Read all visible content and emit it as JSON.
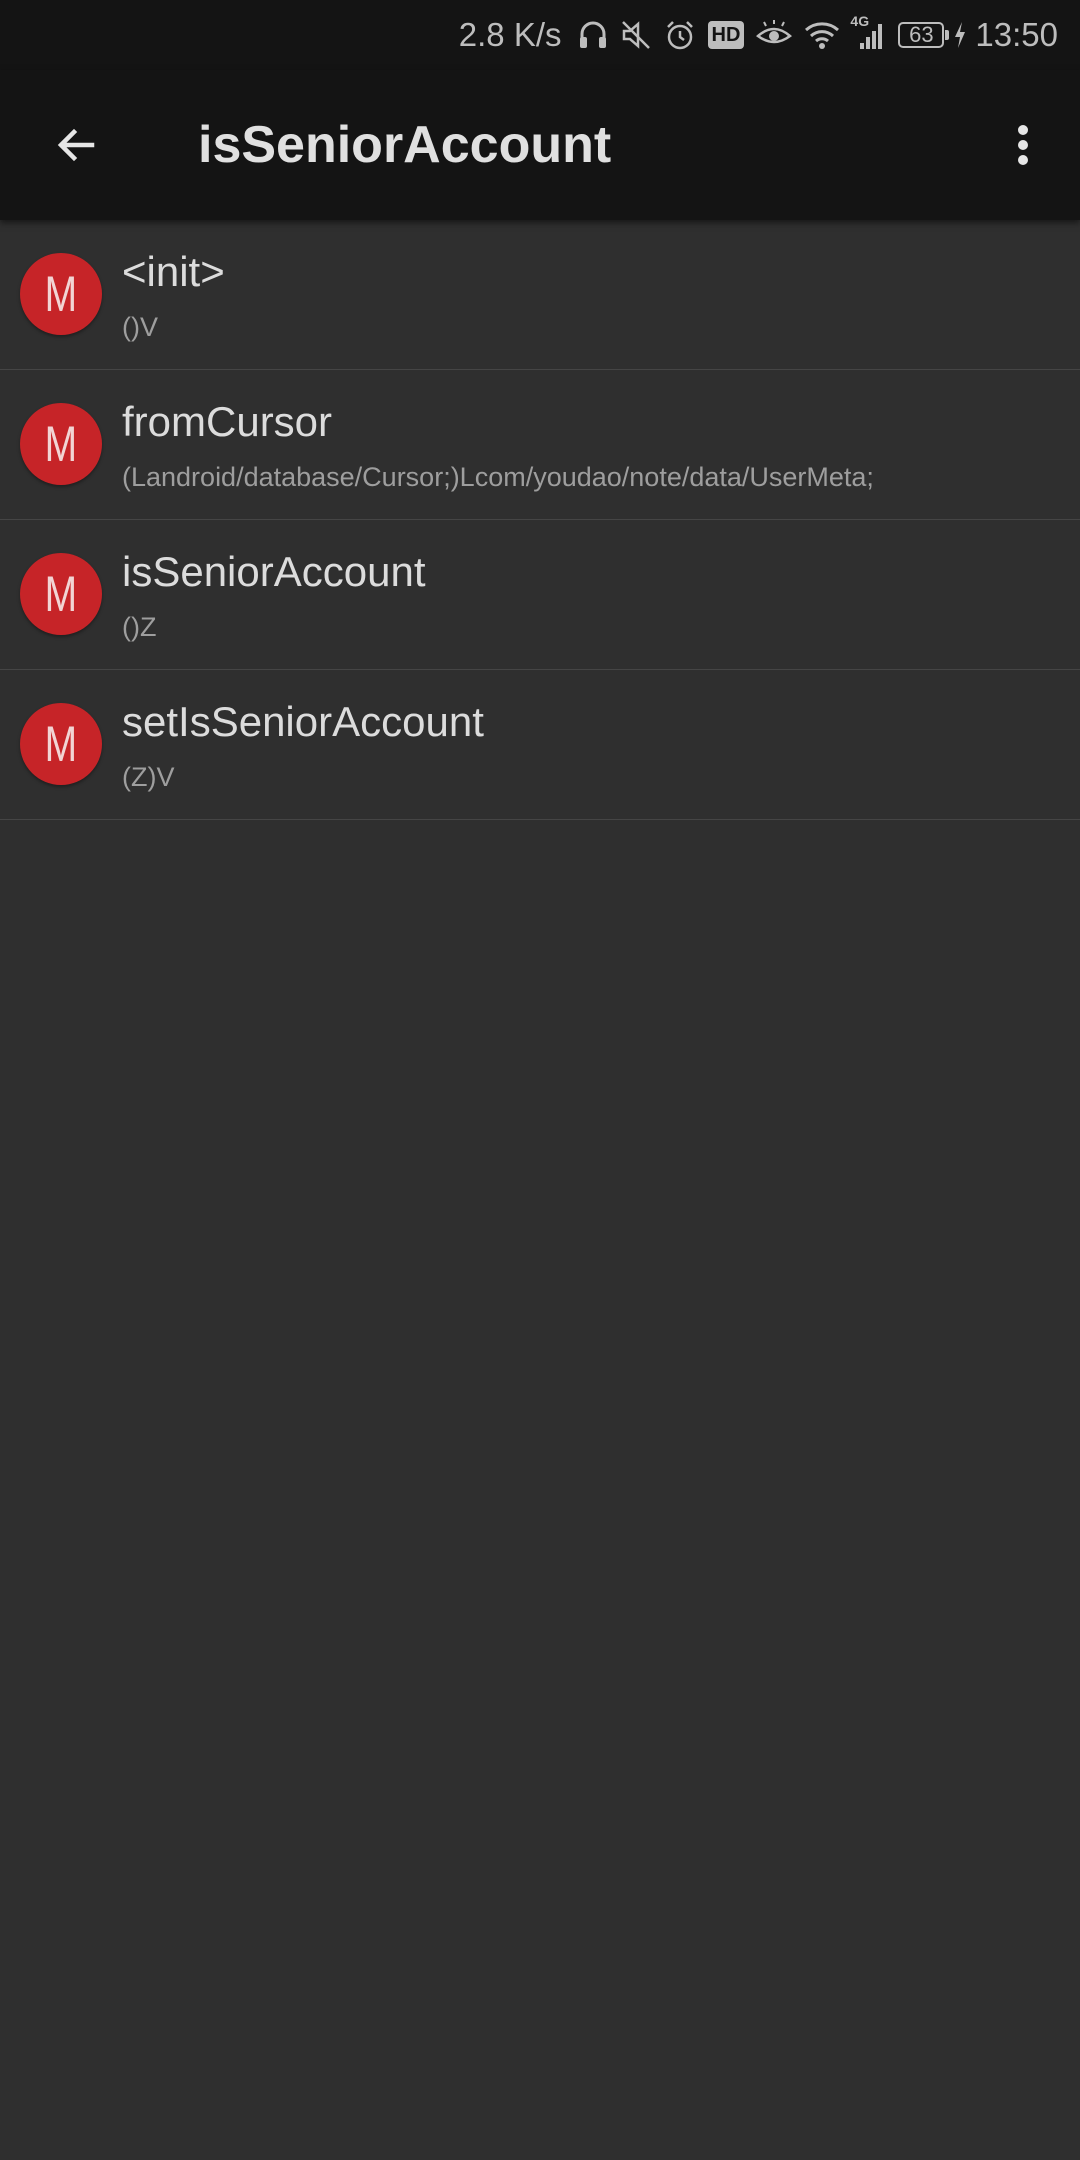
{
  "status_bar": {
    "net_speed": "2.8 K/s",
    "hd_badge": "HD",
    "network_type": "4G",
    "battery": "63",
    "time": "13:50",
    "icons": [
      "headset-icon",
      "mute-icon",
      "alarm-icon",
      "hd-icon",
      "eye-comfort-icon",
      "wifi-icon",
      "signal-icon",
      "battery-icon",
      "charging-icon"
    ]
  },
  "toolbar": {
    "title": "isSeniorAccount",
    "back_icon": "arrow-back-icon",
    "menu_icon": "more-vert-icon"
  },
  "methods": [
    {
      "badge": "M",
      "name": "<init>",
      "signature": "()V"
    },
    {
      "badge": "M",
      "name": "fromCursor",
      "signature": "(Landroid/database/Cursor;)Lcom/youdao/note/data/UserMeta;"
    },
    {
      "badge": "M",
      "name": "isSeniorAccount",
      "signature": "()Z"
    },
    {
      "badge": "M",
      "name": "setIsSeniorAccount",
      "signature": "(Z)V"
    }
  ],
  "colors": {
    "background": "#2f2f2f",
    "toolbar": "#141414",
    "badge": "#c62428",
    "title_text": "#e0e0e0",
    "sub_text": "#9e9e9e",
    "divider": "#454545"
  }
}
